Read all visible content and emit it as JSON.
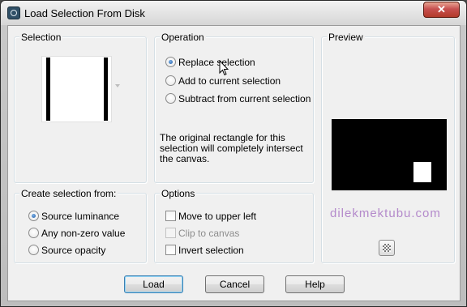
{
  "window": {
    "title": "Load Selection From Disk",
    "close_label": "✕"
  },
  "selection_group": {
    "label": "Selection"
  },
  "operation_group": {
    "label": "Operation",
    "options": [
      {
        "label": "Replace selection",
        "checked": true
      },
      {
        "label": "Add to current selection",
        "checked": false
      },
      {
        "label": "Subtract from current selection",
        "checked": false
      }
    ],
    "description": "The original rectangle for this selection will completely intersect the canvas."
  },
  "preview_group": {
    "label": "Preview",
    "watermark": "dilekmektubu.com"
  },
  "create_group": {
    "label": "Create selection from:",
    "options": [
      {
        "label": "Source luminance",
        "checked": true
      },
      {
        "label": "Any non-zero value",
        "checked": false
      },
      {
        "label": "Source opacity",
        "checked": false
      }
    ]
  },
  "options_group": {
    "label": "Options",
    "items": [
      {
        "label": "Move to upper left",
        "checked": false,
        "enabled": true
      },
      {
        "label": "Clip to canvas",
        "checked": false,
        "enabled": false
      },
      {
        "label": "Invert selection",
        "checked": false,
        "enabled": true
      }
    ]
  },
  "buttons": {
    "load": "Load",
    "cancel": "Cancel",
    "help": "Help"
  },
  "colors": {
    "close": "#c75050",
    "watermark": "#b48acb",
    "default_button_border": "#3c7fb1"
  }
}
